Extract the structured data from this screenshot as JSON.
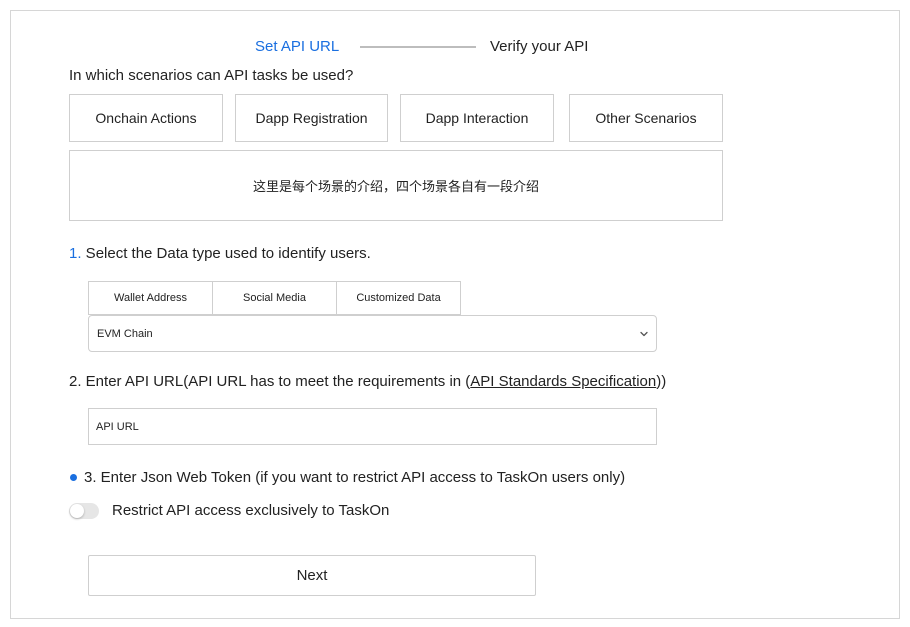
{
  "stepper": {
    "step1": "Set API URL",
    "step2": "Verify your API",
    "active_color": "#1a6fe0"
  },
  "scenarios": {
    "question": "In which scenarios can API tasks be used?",
    "options": [
      "Onchain Actions",
      "Dapp Registration",
      "Dapp Interaction",
      "Other Scenarios"
    ],
    "intro": "这里是每个场景的介绍，四个场景各自有一段介绍"
  },
  "data_type": {
    "number": "1.",
    "title": " Select the Data type used to identify users.",
    "options": [
      "Wallet Address",
      "Social Media",
      "Customized Data"
    ],
    "chain_selected": "EVM Chain",
    "chevron_icon": "chevron-down-icon"
  },
  "api_url": {
    "title_prefix": "2. Enter API URL(API URL has to meet the requirements in (",
    "link_text": "API Standards Specification",
    "title_suffix": "))",
    "placeholder": "API URL"
  },
  "jwt": {
    "title": "3. Enter Json Web Token (if you want to restrict API access to TaskOn users only)",
    "toggle_label": "Restrict API access exclusively to TaskOn",
    "toggle_on": false
  },
  "actions": {
    "next_label": "Next"
  }
}
